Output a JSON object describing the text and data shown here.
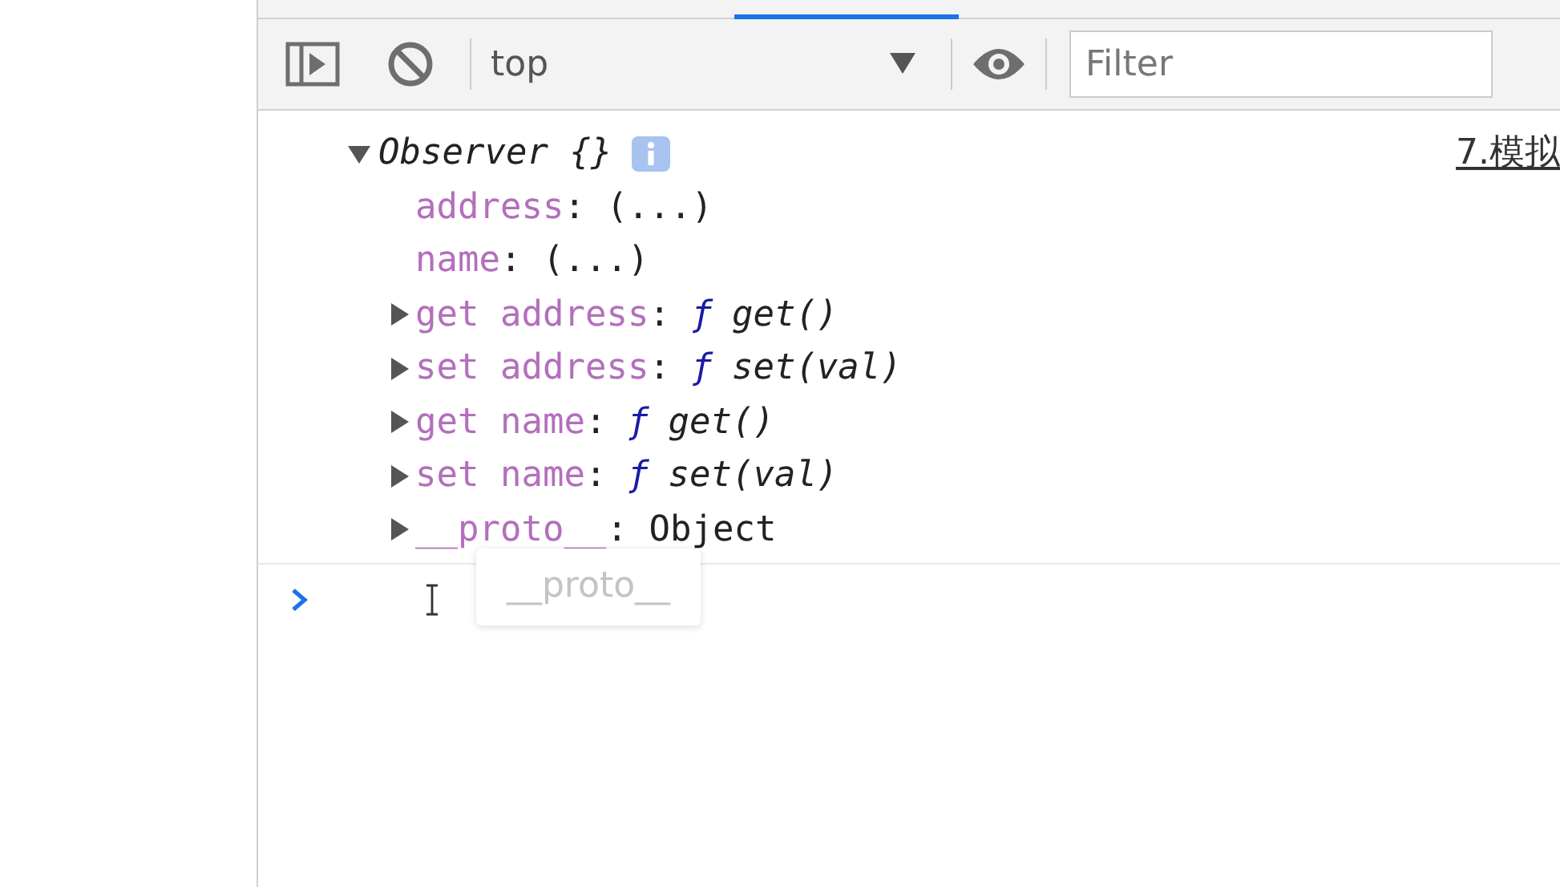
{
  "toolbar": {
    "context": "top",
    "filter": {
      "placeholder": "Filter"
    }
  },
  "console": {
    "object": {
      "label": "Observer {}",
      "expanded": true,
      "source": "7.模拟",
      "properties": [
        {
          "kind": "plain",
          "key": "address",
          "separator": ":",
          "value": "(...)"
        },
        {
          "kind": "plain",
          "key": "name",
          "separator": ":",
          "value": "(...)"
        },
        {
          "kind": "accessor",
          "key": "get address",
          "separator": ":",
          "mark": "ƒ",
          "value": "get()",
          "expanded": false
        },
        {
          "kind": "accessor",
          "key": "set address",
          "separator": ":",
          "mark": "ƒ",
          "value": "set(val)",
          "expanded": false
        },
        {
          "kind": "accessor",
          "key": "get name",
          "separator": ":",
          "mark": "ƒ",
          "value": "get()",
          "expanded": false
        },
        {
          "kind": "accessor",
          "key": "set name",
          "separator": ":",
          "mark": "ƒ",
          "value": "set(val)",
          "expanded": false
        },
        {
          "kind": "proto",
          "key": "__proto__",
          "separator": ":",
          "value": "Object",
          "expanded": false
        }
      ]
    }
  },
  "prompt": {
    "suggestion": "__proto__"
  }
}
